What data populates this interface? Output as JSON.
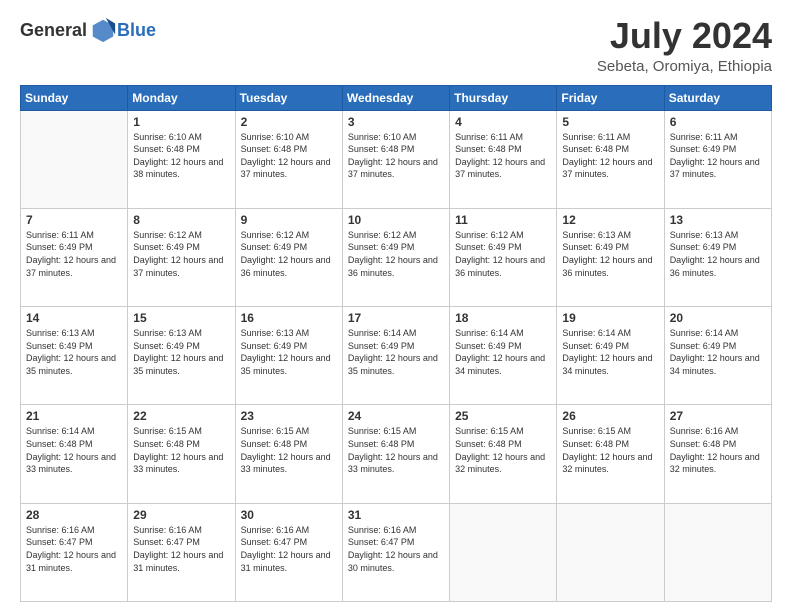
{
  "header": {
    "logo_general": "General",
    "logo_blue": "Blue",
    "month_title": "July 2024",
    "location": "Sebeta, Oromiya, Ethiopia"
  },
  "days_of_week": [
    "Sunday",
    "Monday",
    "Tuesday",
    "Wednesday",
    "Thursday",
    "Friday",
    "Saturday"
  ],
  "weeks": [
    [
      {
        "day": "",
        "sunrise": "",
        "sunset": "",
        "daylight": ""
      },
      {
        "day": "1",
        "sunrise": "Sunrise: 6:10 AM",
        "sunset": "Sunset: 6:48 PM",
        "daylight": "Daylight: 12 hours and 38 minutes."
      },
      {
        "day": "2",
        "sunrise": "Sunrise: 6:10 AM",
        "sunset": "Sunset: 6:48 PM",
        "daylight": "Daylight: 12 hours and 37 minutes."
      },
      {
        "day": "3",
        "sunrise": "Sunrise: 6:10 AM",
        "sunset": "Sunset: 6:48 PM",
        "daylight": "Daylight: 12 hours and 37 minutes."
      },
      {
        "day": "4",
        "sunrise": "Sunrise: 6:11 AM",
        "sunset": "Sunset: 6:48 PM",
        "daylight": "Daylight: 12 hours and 37 minutes."
      },
      {
        "day": "5",
        "sunrise": "Sunrise: 6:11 AM",
        "sunset": "Sunset: 6:48 PM",
        "daylight": "Daylight: 12 hours and 37 minutes."
      },
      {
        "day": "6",
        "sunrise": "Sunrise: 6:11 AM",
        "sunset": "Sunset: 6:49 PM",
        "daylight": "Daylight: 12 hours and 37 minutes."
      }
    ],
    [
      {
        "day": "7",
        "sunrise": "Sunrise: 6:11 AM",
        "sunset": "Sunset: 6:49 PM",
        "daylight": "Daylight: 12 hours and 37 minutes."
      },
      {
        "day": "8",
        "sunrise": "Sunrise: 6:12 AM",
        "sunset": "Sunset: 6:49 PM",
        "daylight": "Daylight: 12 hours and 37 minutes."
      },
      {
        "day": "9",
        "sunrise": "Sunrise: 6:12 AM",
        "sunset": "Sunset: 6:49 PM",
        "daylight": "Daylight: 12 hours and 36 minutes."
      },
      {
        "day": "10",
        "sunrise": "Sunrise: 6:12 AM",
        "sunset": "Sunset: 6:49 PM",
        "daylight": "Daylight: 12 hours and 36 minutes."
      },
      {
        "day": "11",
        "sunrise": "Sunrise: 6:12 AM",
        "sunset": "Sunset: 6:49 PM",
        "daylight": "Daylight: 12 hours and 36 minutes."
      },
      {
        "day": "12",
        "sunrise": "Sunrise: 6:13 AM",
        "sunset": "Sunset: 6:49 PM",
        "daylight": "Daylight: 12 hours and 36 minutes."
      },
      {
        "day": "13",
        "sunrise": "Sunrise: 6:13 AM",
        "sunset": "Sunset: 6:49 PM",
        "daylight": "Daylight: 12 hours and 36 minutes."
      }
    ],
    [
      {
        "day": "14",
        "sunrise": "Sunrise: 6:13 AM",
        "sunset": "Sunset: 6:49 PM",
        "daylight": "Daylight: 12 hours and 35 minutes."
      },
      {
        "day": "15",
        "sunrise": "Sunrise: 6:13 AM",
        "sunset": "Sunset: 6:49 PM",
        "daylight": "Daylight: 12 hours and 35 minutes."
      },
      {
        "day": "16",
        "sunrise": "Sunrise: 6:13 AM",
        "sunset": "Sunset: 6:49 PM",
        "daylight": "Daylight: 12 hours and 35 minutes."
      },
      {
        "day": "17",
        "sunrise": "Sunrise: 6:14 AM",
        "sunset": "Sunset: 6:49 PM",
        "daylight": "Daylight: 12 hours and 35 minutes."
      },
      {
        "day": "18",
        "sunrise": "Sunrise: 6:14 AM",
        "sunset": "Sunset: 6:49 PM",
        "daylight": "Daylight: 12 hours and 34 minutes."
      },
      {
        "day": "19",
        "sunrise": "Sunrise: 6:14 AM",
        "sunset": "Sunset: 6:49 PM",
        "daylight": "Daylight: 12 hours and 34 minutes."
      },
      {
        "day": "20",
        "sunrise": "Sunrise: 6:14 AM",
        "sunset": "Sunset: 6:49 PM",
        "daylight": "Daylight: 12 hours and 34 minutes."
      }
    ],
    [
      {
        "day": "21",
        "sunrise": "Sunrise: 6:14 AM",
        "sunset": "Sunset: 6:48 PM",
        "daylight": "Daylight: 12 hours and 33 minutes."
      },
      {
        "day": "22",
        "sunrise": "Sunrise: 6:15 AM",
        "sunset": "Sunset: 6:48 PM",
        "daylight": "Daylight: 12 hours and 33 minutes."
      },
      {
        "day": "23",
        "sunrise": "Sunrise: 6:15 AM",
        "sunset": "Sunset: 6:48 PM",
        "daylight": "Daylight: 12 hours and 33 minutes."
      },
      {
        "day": "24",
        "sunrise": "Sunrise: 6:15 AM",
        "sunset": "Sunset: 6:48 PM",
        "daylight": "Daylight: 12 hours and 33 minutes."
      },
      {
        "day": "25",
        "sunrise": "Sunrise: 6:15 AM",
        "sunset": "Sunset: 6:48 PM",
        "daylight": "Daylight: 12 hours and 32 minutes."
      },
      {
        "day": "26",
        "sunrise": "Sunrise: 6:15 AM",
        "sunset": "Sunset: 6:48 PM",
        "daylight": "Daylight: 12 hours and 32 minutes."
      },
      {
        "day": "27",
        "sunrise": "Sunrise: 6:16 AM",
        "sunset": "Sunset: 6:48 PM",
        "daylight": "Daylight: 12 hours and 32 minutes."
      }
    ],
    [
      {
        "day": "28",
        "sunrise": "Sunrise: 6:16 AM",
        "sunset": "Sunset: 6:47 PM",
        "daylight": "Daylight: 12 hours and 31 minutes."
      },
      {
        "day": "29",
        "sunrise": "Sunrise: 6:16 AM",
        "sunset": "Sunset: 6:47 PM",
        "daylight": "Daylight: 12 hours and 31 minutes."
      },
      {
        "day": "30",
        "sunrise": "Sunrise: 6:16 AM",
        "sunset": "Sunset: 6:47 PM",
        "daylight": "Daylight: 12 hours and 31 minutes."
      },
      {
        "day": "31",
        "sunrise": "Sunrise: 6:16 AM",
        "sunset": "Sunset: 6:47 PM",
        "daylight": "Daylight: 12 hours and 30 minutes."
      },
      {
        "day": "",
        "sunrise": "",
        "sunset": "",
        "daylight": ""
      },
      {
        "day": "",
        "sunrise": "",
        "sunset": "",
        "daylight": ""
      },
      {
        "day": "",
        "sunrise": "",
        "sunset": "",
        "daylight": ""
      }
    ]
  ]
}
